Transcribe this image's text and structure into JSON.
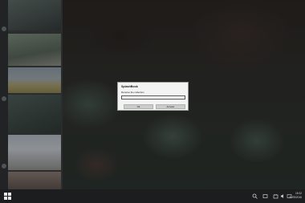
{
  "dialog": {
    "title": "SplashBook",
    "message": "Rename the collection",
    "input_value": "",
    "input_placeholder": "",
    "ok_label": "Ok",
    "cancel_label": "Annuler"
  },
  "taskbar": {
    "time": "18:32",
    "date": "31/05/2016",
    "icons": [
      "windows-start-icon",
      "search-icon",
      "task-view-icon",
      "store-icon",
      "network-icon",
      "volume-icon",
      "notification-icon"
    ]
  },
  "colors": {
    "dialog_bg": "#f3f3f3",
    "button_bg": "#cccccc",
    "taskbar_bg": "#1b1d1f"
  }
}
